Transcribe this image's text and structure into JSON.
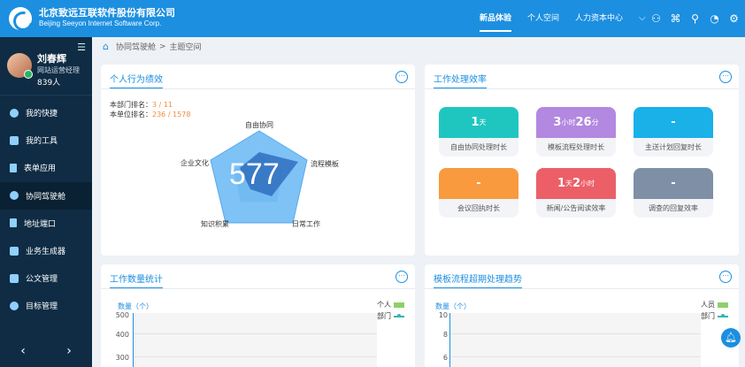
{
  "brand": {
    "name_cn": "北京致远互联软件股份有限公司",
    "name_en": "Beijing Seeyon Internet Software Corp."
  },
  "topnav": [
    "新品体验",
    "个人空间",
    "人力资本中心"
  ],
  "topicons": [
    "user-search-icon",
    "apps-icon",
    "search-icon",
    "chat-icon",
    "settings-icon"
  ],
  "profile": {
    "name": "刘春辉",
    "role": "网站运营经理",
    "count": "839人"
  },
  "menu": [
    "我的快捷",
    "我的工具",
    "表单应用",
    "协同驾驶舱",
    "地址端口",
    "业务生成器",
    "公文管理",
    "目标管理"
  ],
  "breadcrumb": {
    "section": "协同驾驶舱",
    "sep": ">",
    "page": "主题空间"
  },
  "card_behavior": {
    "title": "个人行为绩效",
    "dept_rank_label": "本部门排名：",
    "dept_rank_value": "3 / 11",
    "unit_rank_label": "本单位排名：",
    "unit_rank_value": "236 / 1578",
    "score": "577",
    "axes": [
      "自由协同",
      "流程模板",
      "日常工作",
      "知识积累",
      "企业文化"
    ]
  },
  "card_efficiency": {
    "title": "工作处理效率",
    "tiles": [
      {
        "value": "1",
        "unit": "天",
        "value2": "",
        "unit2": "",
        "label": "自由协同处理时长",
        "color": "#1fc6c0"
      },
      {
        "value": "3",
        "unit": "小时",
        "value2": "26",
        "unit2": "分",
        "label": "模板流程处理时长",
        "color": "#b388e0"
      },
      {
        "value": "-",
        "unit": "",
        "value2": "",
        "unit2": "",
        "label": "主送计划回复时长",
        "color": "#1ab0e8"
      },
      {
        "value": "-",
        "unit": "",
        "value2": "",
        "unit2": "",
        "label": "会议回执时长",
        "color": "#f99a3f"
      },
      {
        "value": "1",
        "unit": "天",
        "value2": "2",
        "unit2": "小时",
        "label": "新闻/公告阅读效率",
        "color": "#ec5f67"
      },
      {
        "value": "-",
        "unit": "",
        "value2": "",
        "unit2": "",
        "label": "调查的回复效率",
        "color": "#7f8fa6"
      }
    ]
  },
  "card_work_stats": {
    "title": "工作数量统计",
    "ylabel": "数量（个）",
    "legend": [
      "个人",
      "部门"
    ],
    "yticks": [
      "500",
      "400",
      "300"
    ]
  },
  "card_trend": {
    "title": "模板流程超期处理趋势",
    "ylabel": "数量（个）",
    "legend": [
      "人员",
      "部门"
    ],
    "yticks": [
      "10",
      "8",
      "6"
    ]
  },
  "colors": {
    "primary": "#1c8fe0",
    "sidebar": "#0f2c44",
    "accent": "#f08c3a"
  }
}
